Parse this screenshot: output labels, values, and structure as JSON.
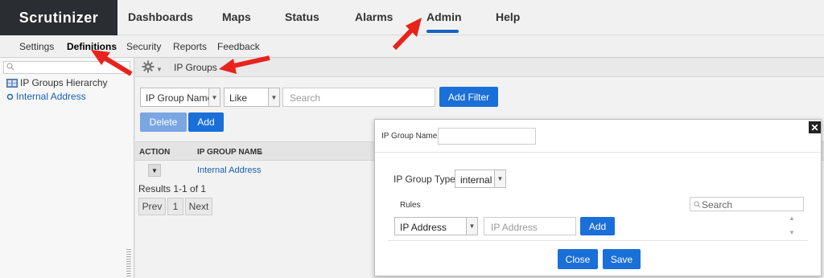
{
  "app": {
    "logo": "Scrutinizer"
  },
  "nav": {
    "items": [
      {
        "label": "Dashboards"
      },
      {
        "label": "Maps"
      },
      {
        "label": "Status"
      },
      {
        "label": "Alarms"
      },
      {
        "label": "Admin"
      },
      {
        "label": "Help"
      }
    ],
    "active": "Admin"
  },
  "subnav": {
    "items": [
      {
        "label": "Settings"
      },
      {
        "label": "Definitions"
      },
      {
        "label": "Security"
      },
      {
        "label": "Reports"
      },
      {
        "label": "Feedback"
      }
    ],
    "active": "Definitions"
  },
  "sidebar": {
    "search_placeholder": "",
    "items": [
      {
        "label": "IP Groups Hierarchy"
      },
      {
        "label": "Internal Address"
      }
    ]
  },
  "main": {
    "title": "IP Groups",
    "filter": {
      "field": "IP Group Name",
      "operator": "Like",
      "search_placeholder": "Search",
      "add_filter": "Add Filter"
    },
    "buttons": {
      "delete": "Delete",
      "add": "Add"
    },
    "table": {
      "columns": [
        "ACTION",
        "IP GROUP NAME"
      ],
      "rows": [
        {
          "ip_group_name": "Internal Address"
        }
      ]
    },
    "results": "Results 1-1 of 1",
    "pagination": {
      "prev": "Prev",
      "page": "1",
      "next": "Next"
    }
  },
  "modal": {
    "name_label": "IP Group Name:",
    "name_value": "",
    "type_label": "IP Group Type:",
    "type_value": "internal",
    "rules_label": "Rules",
    "search_placeholder": "Search",
    "rule_type": "IP Address",
    "rule_placeholder": "IP Address",
    "add": "Add",
    "close": "Close",
    "save": "Save"
  },
  "colors": {
    "primary": "#1a6fd8",
    "arrow": "#e8231c",
    "logo_bg": "#2a2d31"
  }
}
